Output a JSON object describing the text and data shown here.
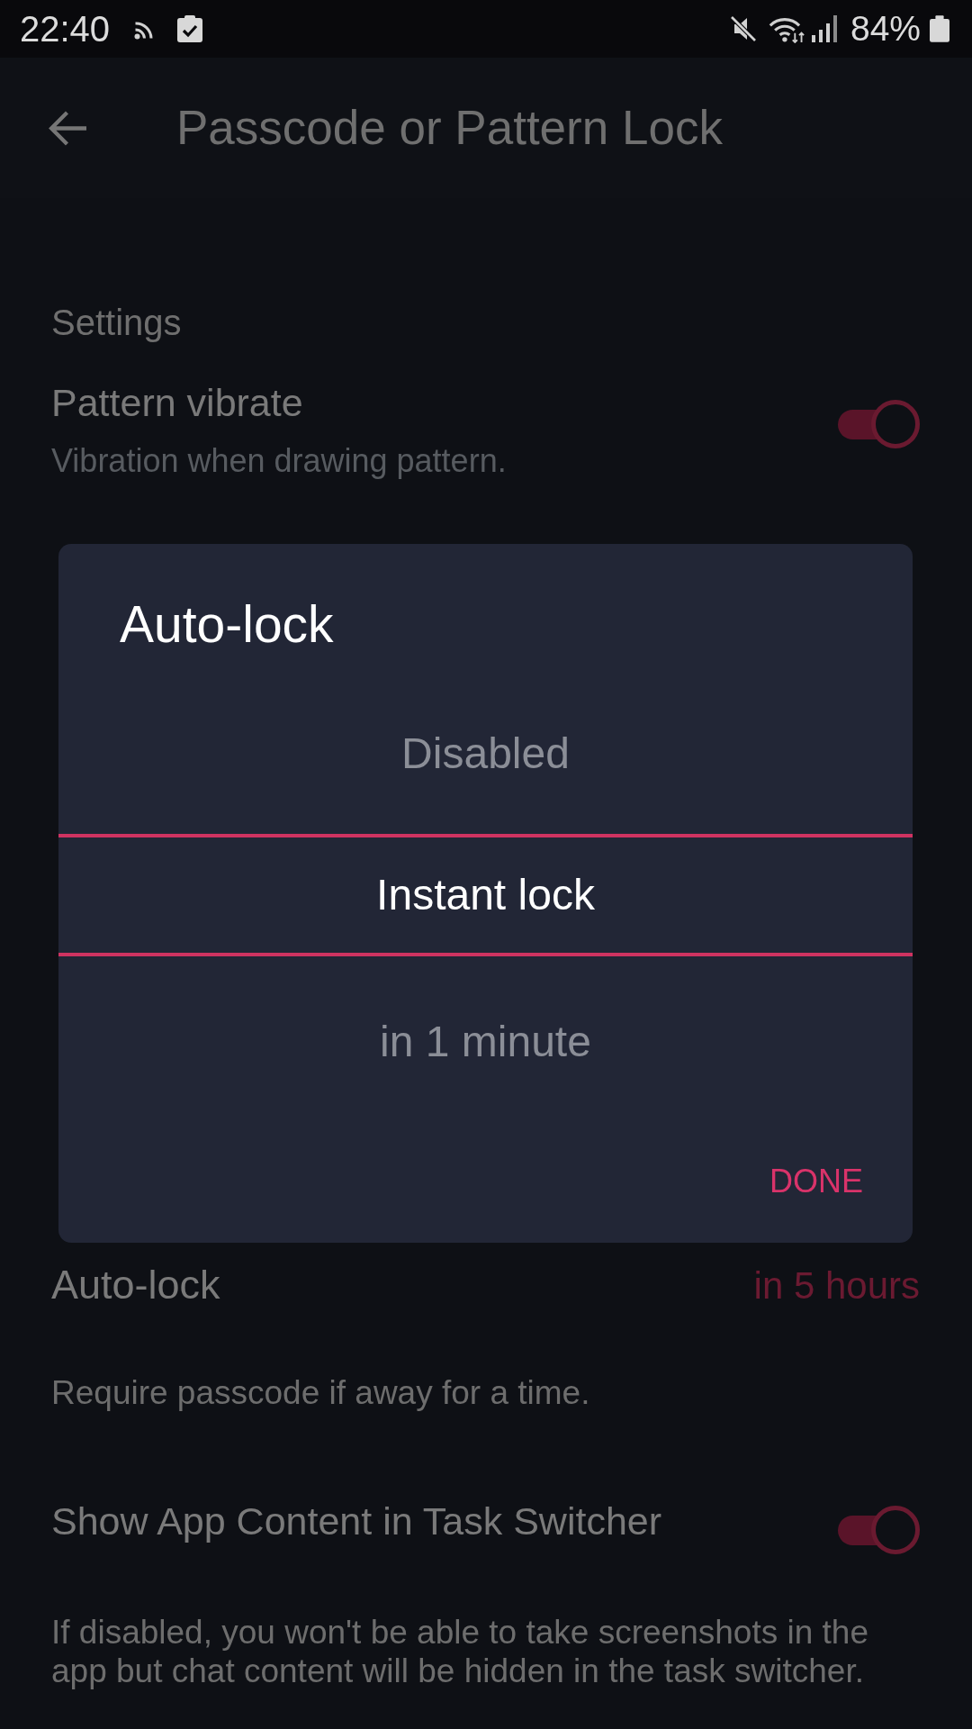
{
  "status_bar": {
    "time": "22:40",
    "battery": "84%"
  },
  "app_bar": {
    "title": "Passcode or Pattern Lock"
  },
  "settings": {
    "section_title": "Settings",
    "items": [
      {
        "kind": "toggle",
        "title": "Pattern vibrate",
        "subtitle": "Vibration when drawing pattern.",
        "on": true
      },
      {
        "kind": "value",
        "title": "Auto-lock",
        "value": "in 5 hours"
      },
      {
        "kind": "note",
        "text": "Require passcode if away for a time."
      },
      {
        "kind": "toggle",
        "title": "Show App Content in Task Switcher",
        "on": true
      },
      {
        "kind": "note",
        "text": "If disabled, you won't be able to take screenshots in the app but chat content will be hidden in the task switcher."
      }
    ]
  },
  "dialog": {
    "title": "Auto-lock",
    "options": [
      {
        "label": "Disabled",
        "selected": false
      },
      {
        "label": "Instant lock",
        "selected": true
      },
      {
        "label": "in 1 minute",
        "selected": false
      }
    ],
    "button": "DONE"
  }
}
